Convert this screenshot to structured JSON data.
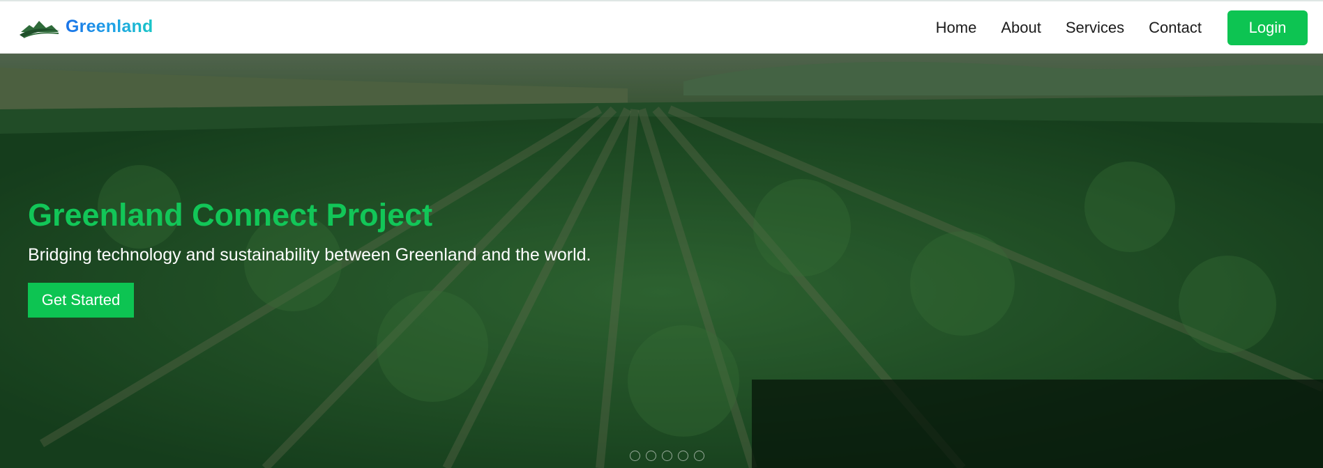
{
  "header": {
    "brand_name": "Greenland",
    "logo_icon": "leaf-mountain-logo",
    "nav": [
      {
        "label": "Home"
      },
      {
        "label": "About"
      },
      {
        "label": "Services"
      },
      {
        "label": "Contact"
      }
    ],
    "login_label": "Login"
  },
  "hero": {
    "title": "Greenland Connect Project",
    "subtitle": "Bridging technology and sustainability between Greenland and the world.",
    "cta_label": "Get Started",
    "background": "cabbage-field-photo",
    "carousel": {
      "slides": 5,
      "active": 1
    }
  },
  "colors": {
    "accent": "#0dc452",
    "title_green": "#12c658",
    "brand_gradient_start": "#1a73e8",
    "brand_gradient_end": "#19c6c6"
  }
}
